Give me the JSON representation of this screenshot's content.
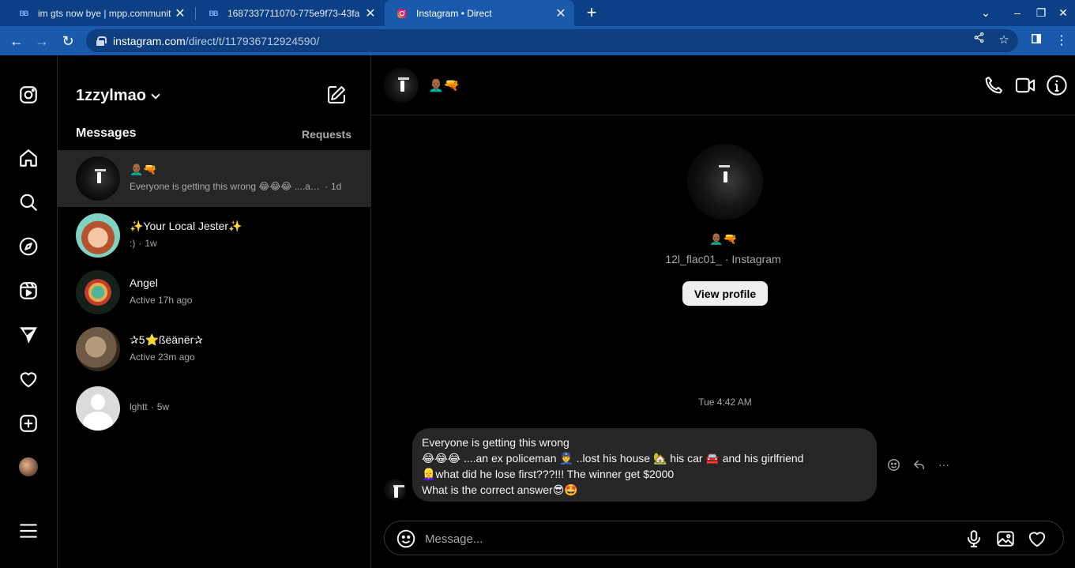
{
  "browser": {
    "tabs": [
      {
        "title": "im gts now bye | mpp.communit",
        "favicon": "BB"
      },
      {
        "title": "1687337711070-775e9f73-43fa",
        "favicon": "BB"
      },
      {
        "title": "Instagram • Direct",
        "favicon": "instagram-icon"
      }
    ],
    "url_host": "instagram.com",
    "url_path": "/direct/t/117936712924590/"
  },
  "inbox": {
    "account": "1zzylmao",
    "messages_label": "Messages",
    "requests_label": "Requests",
    "threads": [
      {
        "name": "👨🏾‍🦲🔫",
        "preview": "Everyone is getting this wrong 😂😂😂 ....an ex policeman",
        "time": "1d"
      },
      {
        "name": "✨Your Local Jester✨",
        "preview": ":)",
        "time": "1w"
      },
      {
        "name": "Angel",
        "status": "Active 17h ago"
      },
      {
        "name": "✰5⭐ßëänër✰",
        "status": "Active 23m ago"
      },
      {
        "name": "",
        "preview": "lghtt",
        "time": "5w"
      }
    ]
  },
  "convo": {
    "header_name": "👨🏾‍🦲🔫",
    "profile_emoji": "👨🏾‍🦲🔫",
    "profile_sub": "12l_flac01_ · Instagram",
    "view_profile_label": "View profile",
    "timestamp": "Tue 4:42 AM",
    "message_lines": [
      "Everyone is getting this wrong",
      "😂😂😂 ....an ex policeman 👮 ..lost his house 🏡 his car 🚘 and his girlfriend",
      "👱‍♀️what did he lose first???!!! The winner get $2000",
      "What is the correct answer😎🤩"
    ],
    "composer_placeholder": "Message..."
  }
}
